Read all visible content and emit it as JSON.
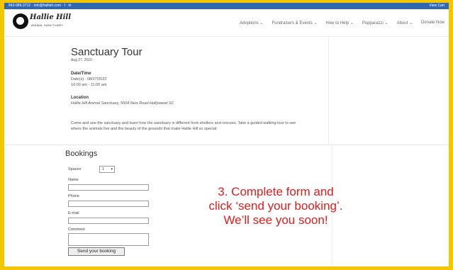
{
  "top_bar": {
    "contact": "843-986-3712 · info@hallieh.com · f · ✉",
    "cart": "View Cart"
  },
  "logo": {
    "name": "Hallie Hill",
    "subtitle": "ANIMAL SANCTUARY"
  },
  "nav": {
    "items": [
      "Adoptions ⌄",
      "Fundraisers & Events ⌄",
      "How to Help ⌄",
      "Pupparazzi ⌄",
      "About ⌄",
      "Donate Now"
    ]
  },
  "event": {
    "title": "Sanctuary Tour",
    "date": "Aug 27, 2022",
    "datetime_heading": "Date/Time",
    "datetime_line1": "Date(s) - 08/27/2022",
    "datetime_line2": "10:00 am - 11:00 am",
    "location_heading": "Location",
    "location_value": "Hallie Hill Animal Sanctuary, 5604 New Road Hollywood SC",
    "description": "Come and see the sanctuary and learn how the sanctuary is different from shelters and rescues. Take a guided walking tour to see where the animals live and the beauty of the grounds that make Hallie Hill so special."
  },
  "booking": {
    "title": "Bookings",
    "spaces_label": "Spaces",
    "spaces_value": "1",
    "name_label": "Name",
    "phone_label": "Phone",
    "email_label": "E-mail",
    "comment_label": "Comment",
    "submit_label": "Send your booking"
  },
  "instruction": {
    "line1": "3. Complete form and",
    "line2": "click ‘send your booking’.",
    "line3": "We’ll see you soon!",
    "color": "#e31b1b"
  },
  "colors": {
    "frame": "#f2c600",
    "top_bar": "#2f67b0"
  }
}
